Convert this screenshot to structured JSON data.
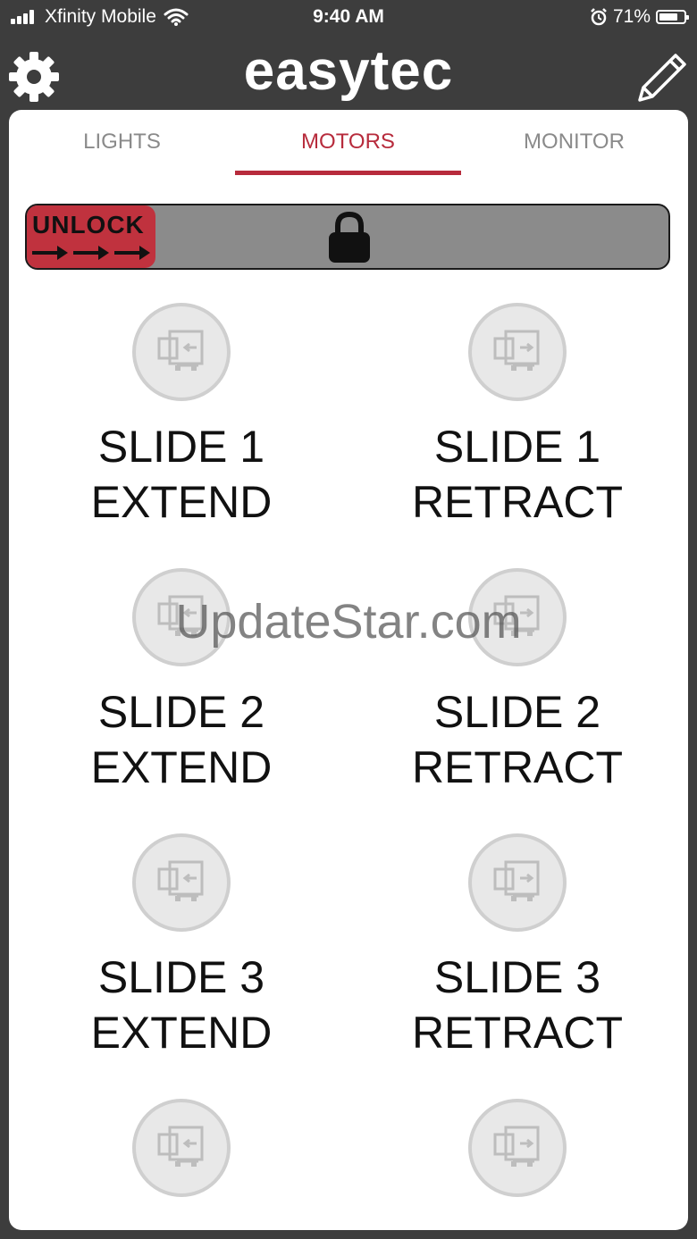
{
  "status_bar": {
    "carrier": "Xfinity Mobile",
    "time": "9:40 AM",
    "battery": "71%",
    "battery_level": 0.71
  },
  "header": {
    "title": "easytec",
    "settings_icon": "gear-icon",
    "edit_icon": "pencil-icon"
  },
  "tabs": [
    {
      "label": "LIGHTS",
      "active": false
    },
    {
      "label": "MOTORS",
      "active": true
    },
    {
      "label": "MONITOR",
      "active": false
    }
  ],
  "unlock": {
    "label": "UNLOCK",
    "icon": "lock-icon"
  },
  "controls": [
    {
      "line1": "SLIDE 1",
      "line2": "EXTEND",
      "icon": "slide-extend-icon"
    },
    {
      "line1": "SLIDE 1",
      "line2": "RETRACT",
      "icon": "slide-retract-icon"
    },
    {
      "line1": "SLIDE 2",
      "line2": "EXTEND",
      "icon": "slide-extend-icon"
    },
    {
      "line1": "SLIDE 2",
      "line2": "RETRACT",
      "icon": "slide-retract-icon"
    },
    {
      "line1": "SLIDE 3",
      "line2": "EXTEND",
      "icon": "slide-extend-icon"
    },
    {
      "line1": "SLIDE 3",
      "line2": "RETRACT",
      "icon": "slide-retract-icon"
    },
    {
      "line1": "",
      "line2": "",
      "icon": "slide-extend-icon"
    },
    {
      "line1": "",
      "line2": "",
      "icon": "slide-retract-icon"
    }
  ],
  "watermark": "UpdateStar.com",
  "colors": {
    "accent": "#b72b3c",
    "background": "#3d3d3d",
    "slider_track": "#8b8b8b",
    "unlock_handle": "#c0323e"
  }
}
